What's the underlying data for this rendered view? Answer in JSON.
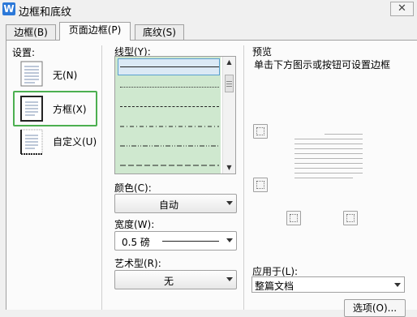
{
  "window": {
    "title": "边框和底纹",
    "close_glyph": "✕",
    "app_icon_letter": "W"
  },
  "tabs": [
    {
      "label": "边框(B)"
    },
    {
      "label": "页面边框(P)",
      "active": true
    },
    {
      "label": "底纹(S)"
    }
  ],
  "settings": {
    "heading": "设置:",
    "options": [
      {
        "label": "无(N)"
      },
      {
        "label": "方框(X)",
        "selected": true
      },
      {
        "label": "自定义(U)"
      }
    ]
  },
  "line_style": {
    "heading": "线型(Y):",
    "styles": [
      "solid",
      "dotted-fine",
      "dashed-small",
      "dash-dot",
      "dash-dot-dot",
      "dashed-long"
    ]
  },
  "color": {
    "label": "颜色(C):",
    "value": "自动"
  },
  "width": {
    "label": "宽度(W):",
    "value": "0.5  磅"
  },
  "art": {
    "label": "艺术型(R):",
    "value": "无"
  },
  "preview": {
    "heading": "预览",
    "hint": "单击下方图示或按钮可设置边框"
  },
  "apply_to": {
    "label": "应用于(L):",
    "value": "整篇文档"
  },
  "options_button": {
    "label": "选项(O)..."
  }
}
